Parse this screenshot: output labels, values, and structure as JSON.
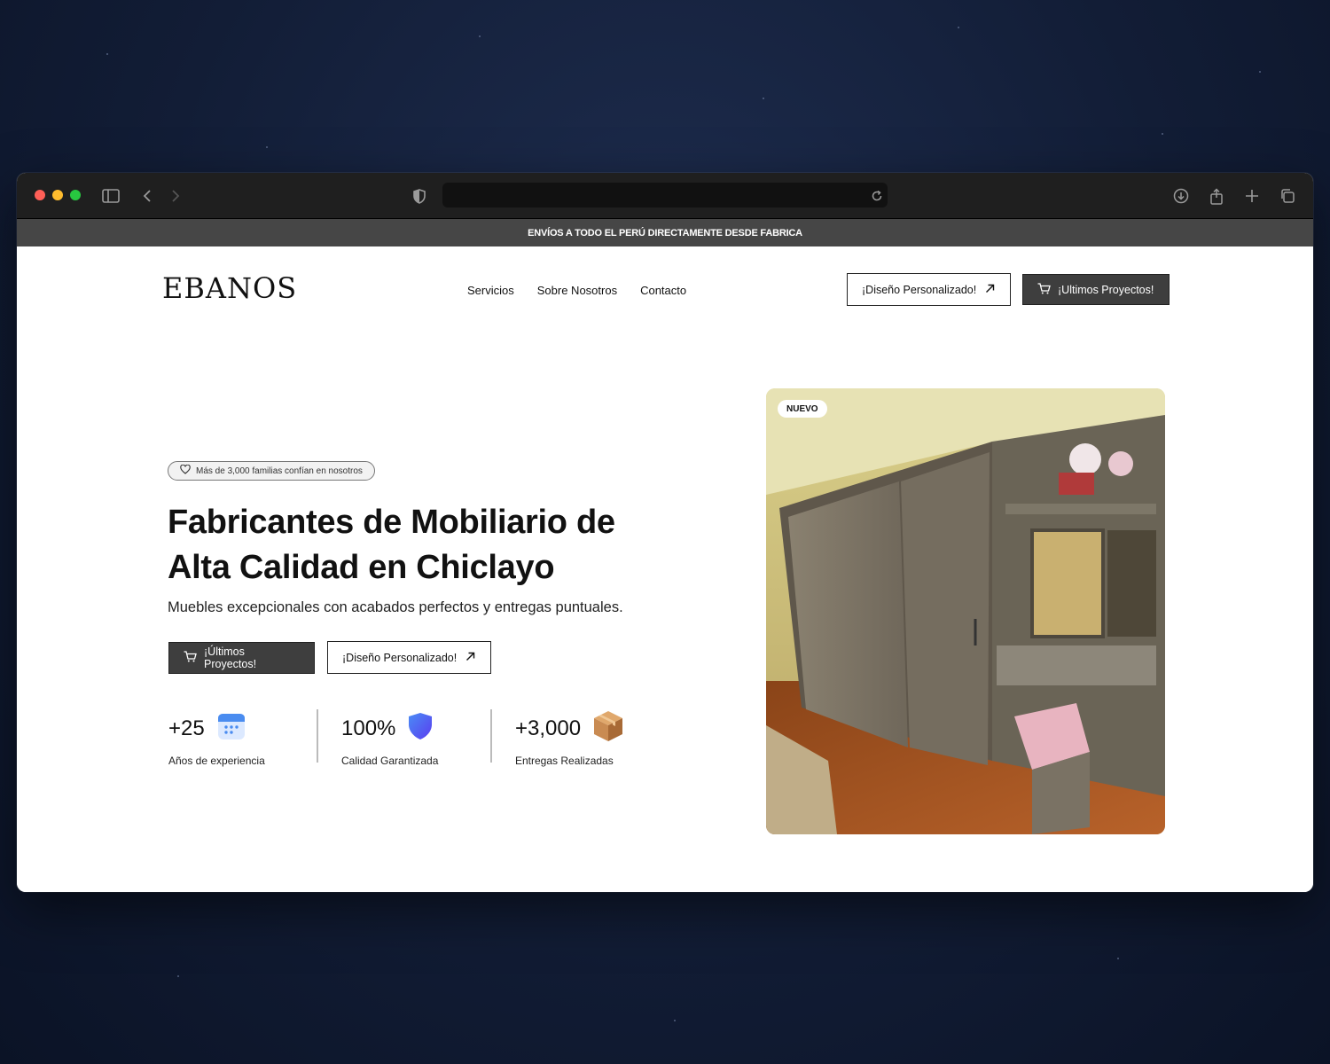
{
  "browser": {
    "url": ""
  },
  "promo": {
    "text": "ENVÍOS A TODO EL PERÚ DIRECTAMENTE DESDE FABRICA"
  },
  "header": {
    "logo": "EBANOS",
    "nav": [
      "Servicios",
      "Sobre Nosotros",
      "Contacto"
    ],
    "custom_design_label": "¡Diseño Personalizado!",
    "projects_label": "¡Ultimos Proyectos!"
  },
  "hero": {
    "badge": "Más de 3,000 familias confían en nosotros",
    "title_line1": "Fabricantes de Mobiliario de",
    "title_line2": "Alta Calidad en Chiclayo",
    "subtitle": "Muebles excepcionales con acabados perfectos y entregas puntuales.",
    "projects_button": "¡Últimos Proyectos!",
    "custom_button": "¡Diseño Personalizado!",
    "image_badge": "NUEVO"
  },
  "stats": [
    {
      "value": "+25",
      "label": "Años de experiencia",
      "icon": "calendar-icon"
    },
    {
      "value": "100%",
      "label": "Calidad Garantizada",
      "icon": "shield-icon"
    },
    {
      "value": "+3,000",
      "label": "Entregas Realizadas",
      "icon": "package-icon"
    }
  ],
  "colors": {
    "dark_button": "#3e3e3e",
    "promo_bar": "#464646",
    "calendar_blue": "#4a8cf0",
    "shield_blue": "#4a5cf5",
    "box_brown": "#c98b52"
  }
}
